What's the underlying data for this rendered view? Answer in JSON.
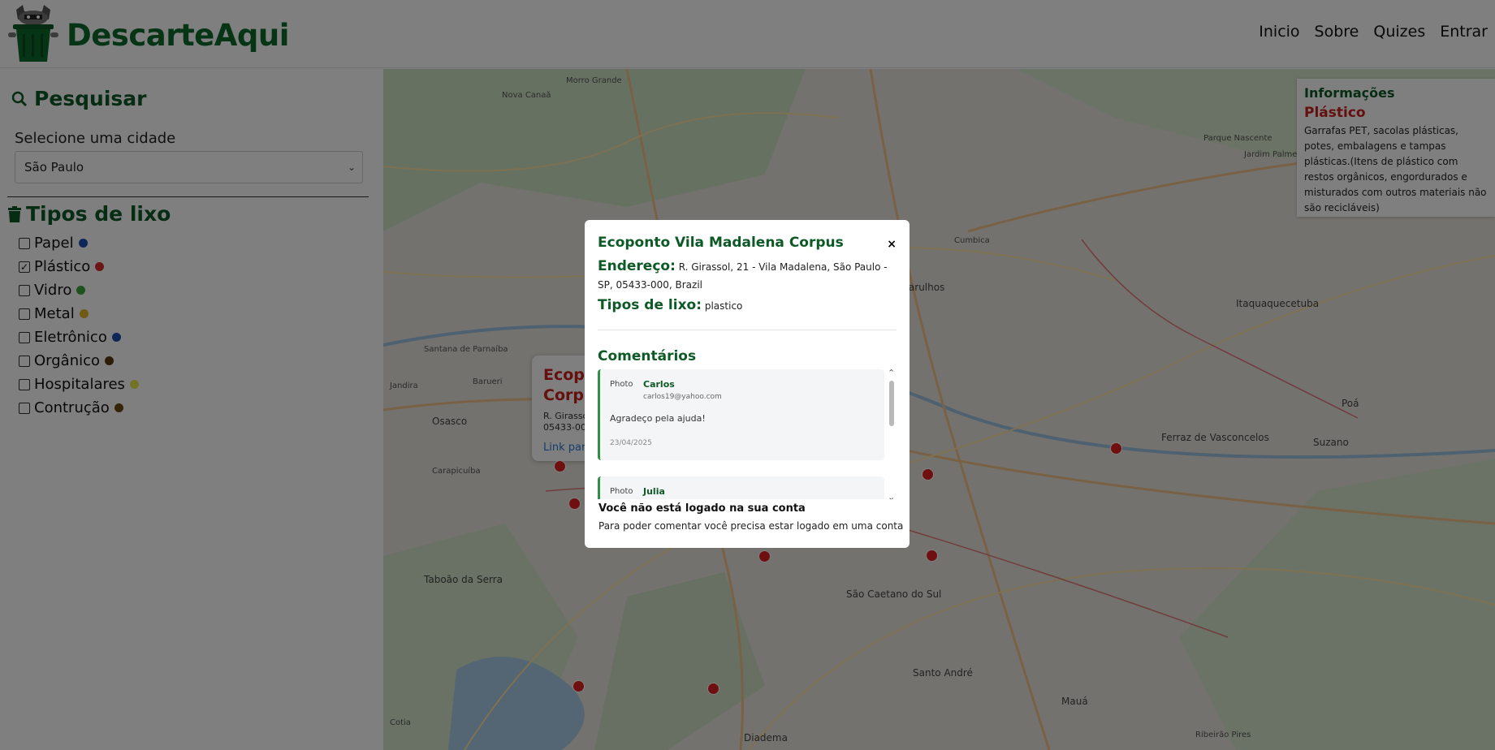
{
  "header": {
    "brand": "DescarteAqui",
    "nav": [
      "Inicio",
      "Sobre",
      "Quizes",
      "Entrar"
    ]
  },
  "sidebar": {
    "search_title": "Pesquisar",
    "city_label": "Selecione uma cidade",
    "city_value": "São Paulo",
    "types_title": "Tipos de lixo",
    "types": [
      {
        "label": "Papel",
        "checked": false,
        "color": "#1d4fb3"
      },
      {
        "label": "Plástico",
        "checked": true,
        "color": "#d92a2a"
      },
      {
        "label": "Vidro",
        "checked": false,
        "color": "#3aa53a"
      },
      {
        "label": "Metal",
        "checked": false,
        "color": "#e3b428"
      },
      {
        "label": "Eletrônico",
        "checked": false,
        "color": "#1d4fb3"
      },
      {
        "label": "Orgânico",
        "checked": false,
        "color": "#5a3a10"
      },
      {
        "label": "Hospitalares",
        "checked": false,
        "color": "#e6e64a"
      },
      {
        "label": "Contrução",
        "checked": false,
        "color": "#6a4a10"
      }
    ]
  },
  "map": {
    "info": {
      "title": "Informações",
      "type": "Plástico",
      "text": "Garrafas PET, sacolas plásticas, potes, embalagens e tampas plásticas.(Itens de plástico com restos orgânicos, engordurados e misturados com outros materiais não são recicláveis)"
    },
    "background_popup": {
      "title_line1": "Ecopo",
      "title_line2": "Corpu",
      "addr_line1": "R. Girasso",
      "addr_line2": "05433-00",
      "link": "Link para"
    },
    "labels": [
      "Nova Canaã",
      "Morro Grande",
      "Parque Nascente",
      "Jardim Palmeiras",
      "Guarulhos",
      "Cumbica",
      "Itaquaquecetuba",
      "Osasco",
      "Poá",
      "Suzano",
      "Ferraz de Vasconcelos",
      "Carapicuíba",
      "Taboão da Serra",
      "São Caetano do Sul",
      "Santo André",
      "Mauá",
      "Diadema",
      "Cotia",
      "Ribeirão Pires",
      "Santana de Parnaíba",
      "Barueri",
      "Jandira"
    ],
    "marker_color": "#e01e1e"
  },
  "modal": {
    "title": "Ecoponto Vila Madalena Corpus",
    "close": "×",
    "address_label": "Endereço:",
    "address": "R. Girassol, 21 - Vila Madalena, São Paulo - SP, 05433-000, Brazil",
    "types_label": "Tipos de lixo:",
    "types_value": "plastico",
    "comments_title": "Comentários",
    "comments": [
      {
        "avatar_alt": "Photo",
        "name": "Carlos",
        "email": "carlos19@yahoo.com",
        "text": "Agradeço pela ajuda!",
        "date": "23/04/2025"
      },
      {
        "avatar_alt": "Photo",
        "name": "Julia",
        "email": "",
        "text": "",
        "date": ""
      }
    ],
    "notice_title": "Você não está logado na sua conta",
    "notice_text": "Para poder comentar você precisa estar logado em uma conta"
  }
}
